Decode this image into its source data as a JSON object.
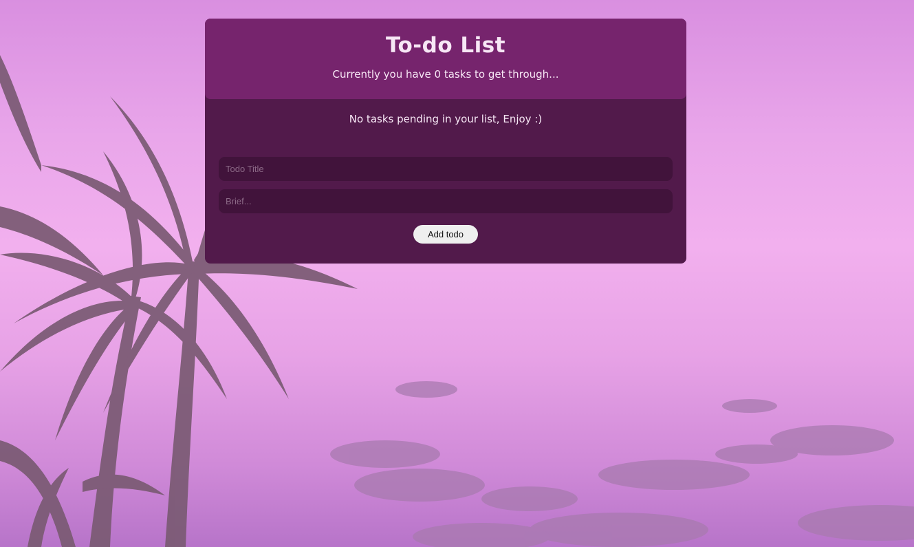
{
  "header": {
    "title": "To-do List",
    "subtitle": "Currently you have 0 tasks to get through..."
  },
  "tasks": {
    "count": 0,
    "empty_message": "No tasks pending in your list, Enjoy :)"
  },
  "form": {
    "title_placeholder": "Todo Title",
    "title_value": "",
    "brief_placeholder": "Brief...",
    "brief_value": "",
    "add_label": "Add todo"
  },
  "colors": {
    "header_bg": "#76246d",
    "card_bg": "#521a4b",
    "input_bg": "#41133b",
    "text": "#f7e7f5"
  }
}
